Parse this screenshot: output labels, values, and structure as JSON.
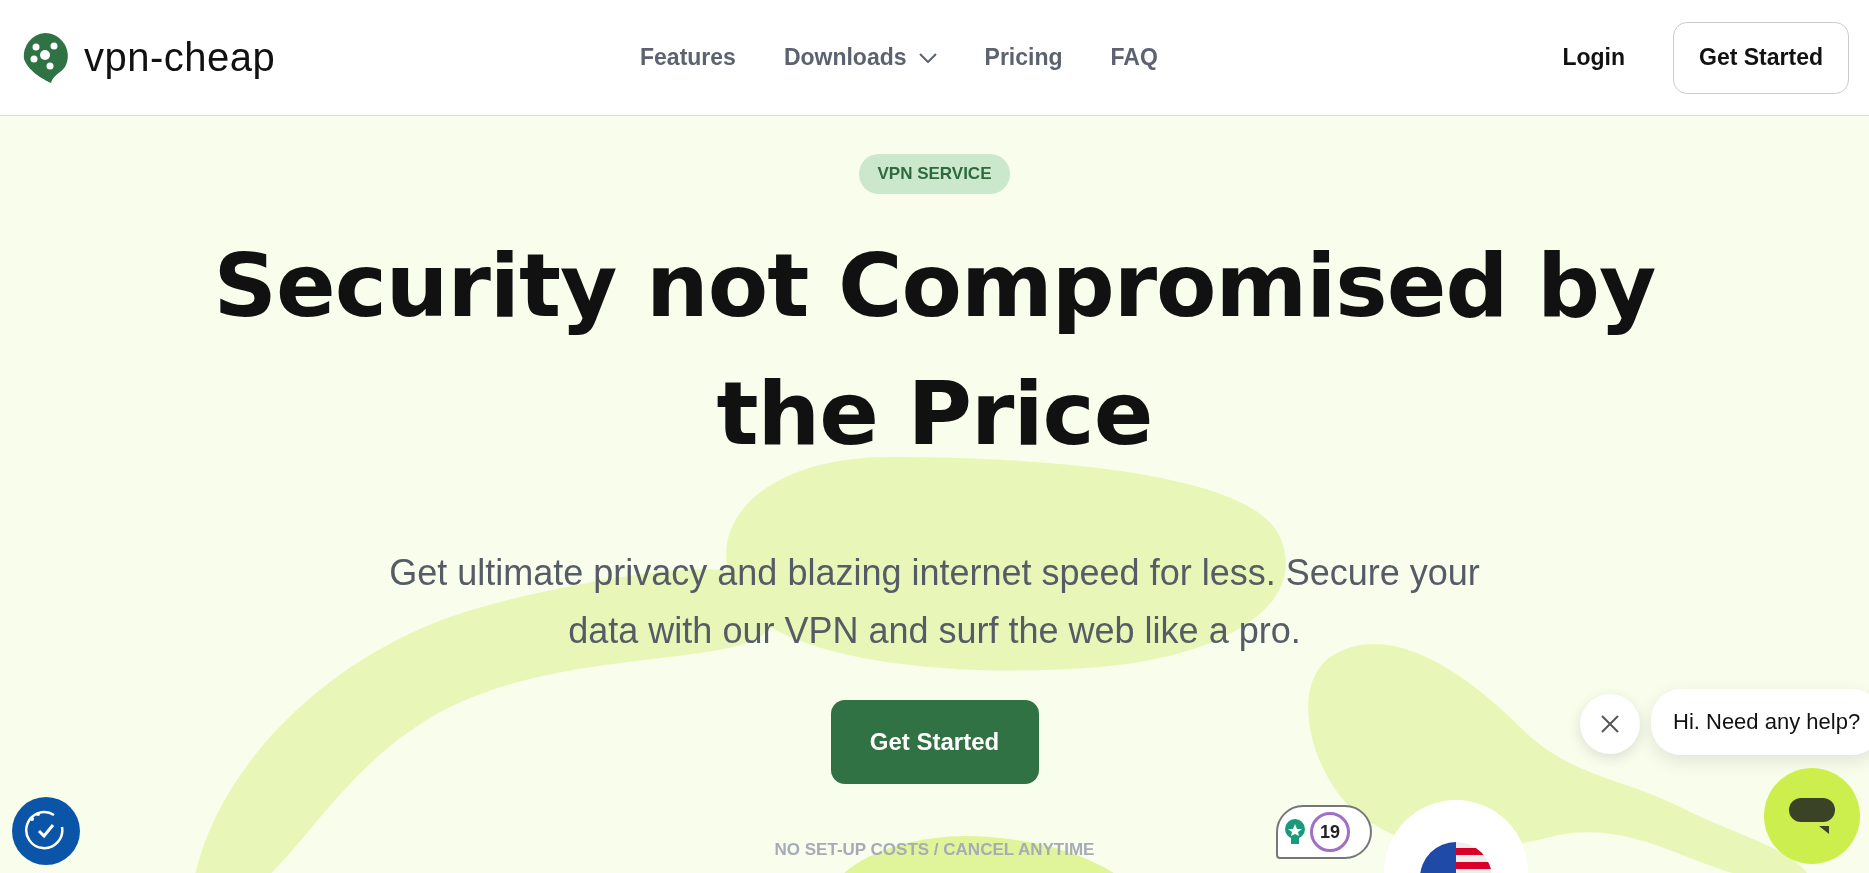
{
  "header": {
    "brand": "vpn-cheap",
    "nav": [
      {
        "label": "Features",
        "kind": "link"
      },
      {
        "label": "Downloads",
        "kind": "dropdown"
      },
      {
        "label": "Pricing",
        "kind": "link"
      },
      {
        "label": "FAQ",
        "kind": "link"
      }
    ],
    "login": "Login",
    "cta": "Get Started"
  },
  "hero": {
    "badge": "VPN SERVICE",
    "title": "Security not Compromised by the Price",
    "subtitle": "Get ultimate privacy and blazing internet speed for less. Secure your data with our VPN and surf the web like a pro.",
    "cta": "Get Started",
    "note": "NO SET-UP COSTS / CANCEL ANYTIME"
  },
  "widgets": {
    "chat_message": "Hi. Need any help?",
    "badge_count": "19"
  }
}
